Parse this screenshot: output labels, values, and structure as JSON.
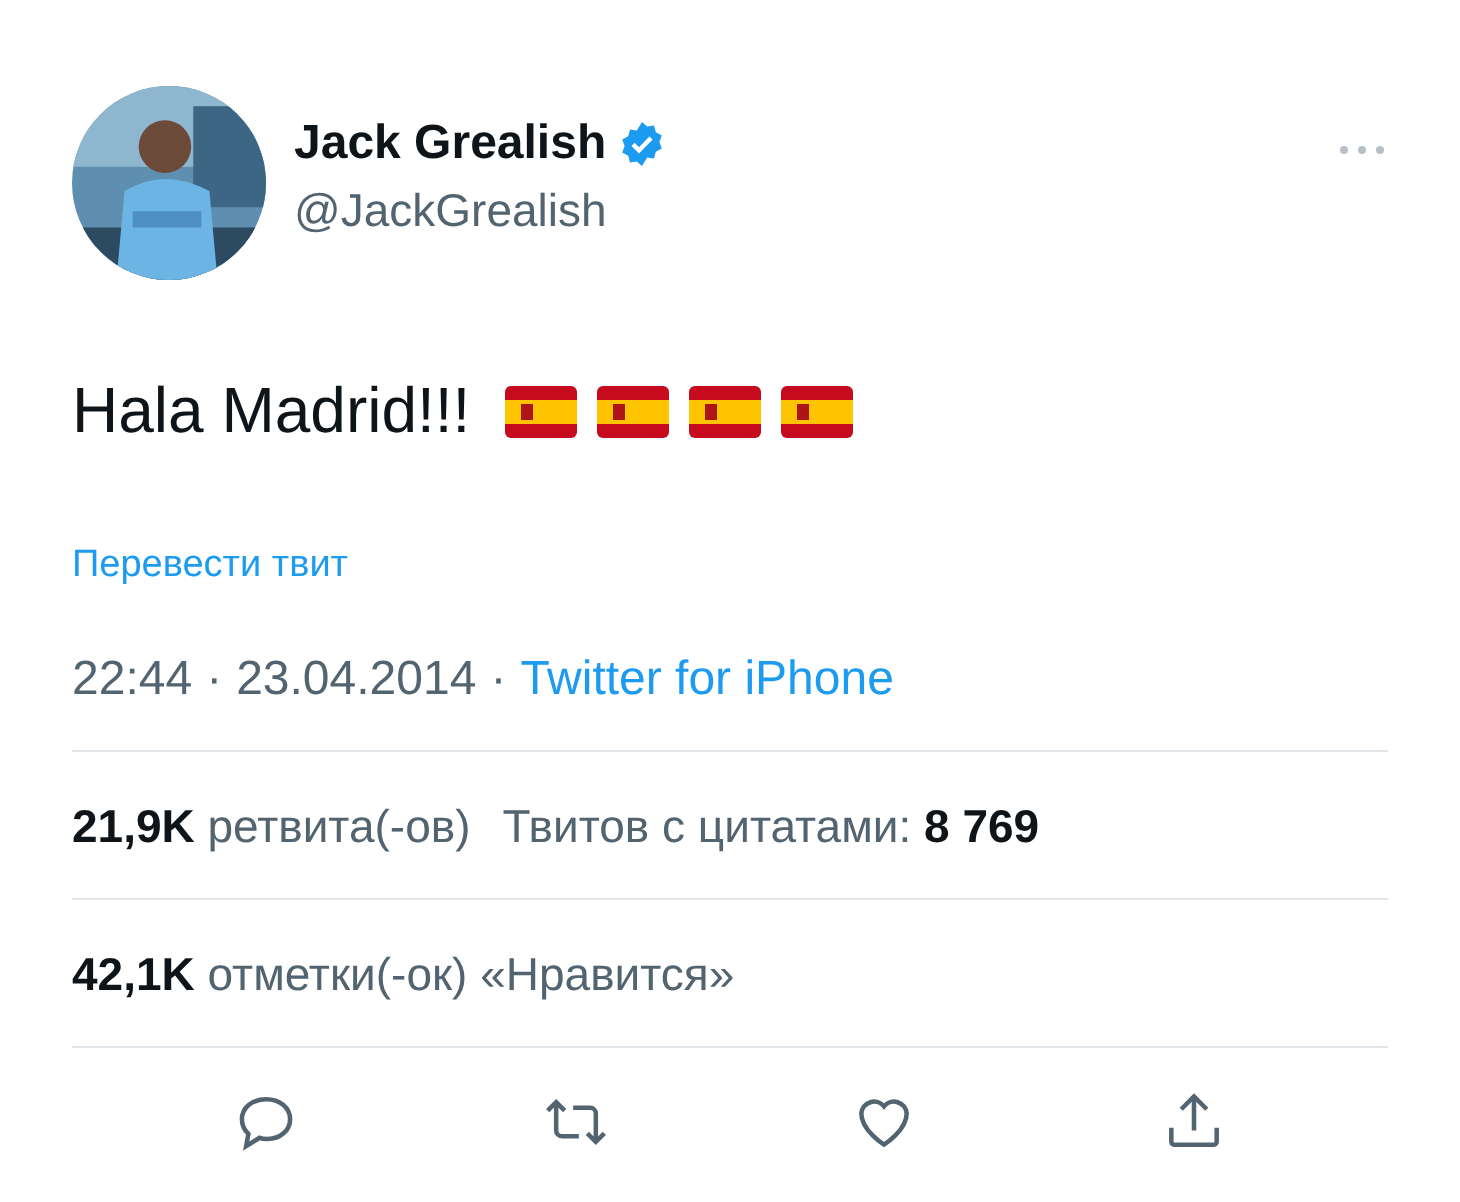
{
  "author": {
    "name": "Jack Grealish",
    "verified": true,
    "handle": "@JackGrealish"
  },
  "tweet": {
    "text": "Hala Madrid!!!",
    "emoji": [
      {
        "kind": "spain-flag"
      },
      {
        "kind": "spain-flag"
      },
      {
        "kind": "spain-flag"
      },
      {
        "kind": "spain-flag"
      }
    ]
  },
  "translate_link": "Перевести твит",
  "meta": {
    "time": "22:44",
    "separator_1": "·",
    "date": "23.04.2014",
    "separator_2": "·",
    "source": "Twitter for iPhone"
  },
  "retweets": {
    "count": "21,9K",
    "label": "ретвита(-ов)"
  },
  "quotes": {
    "label": "Твитов с цитатами:",
    "count": "8 769"
  },
  "likes": {
    "count": "42,1K",
    "label": "отметки(-ок) «Нравится»"
  }
}
